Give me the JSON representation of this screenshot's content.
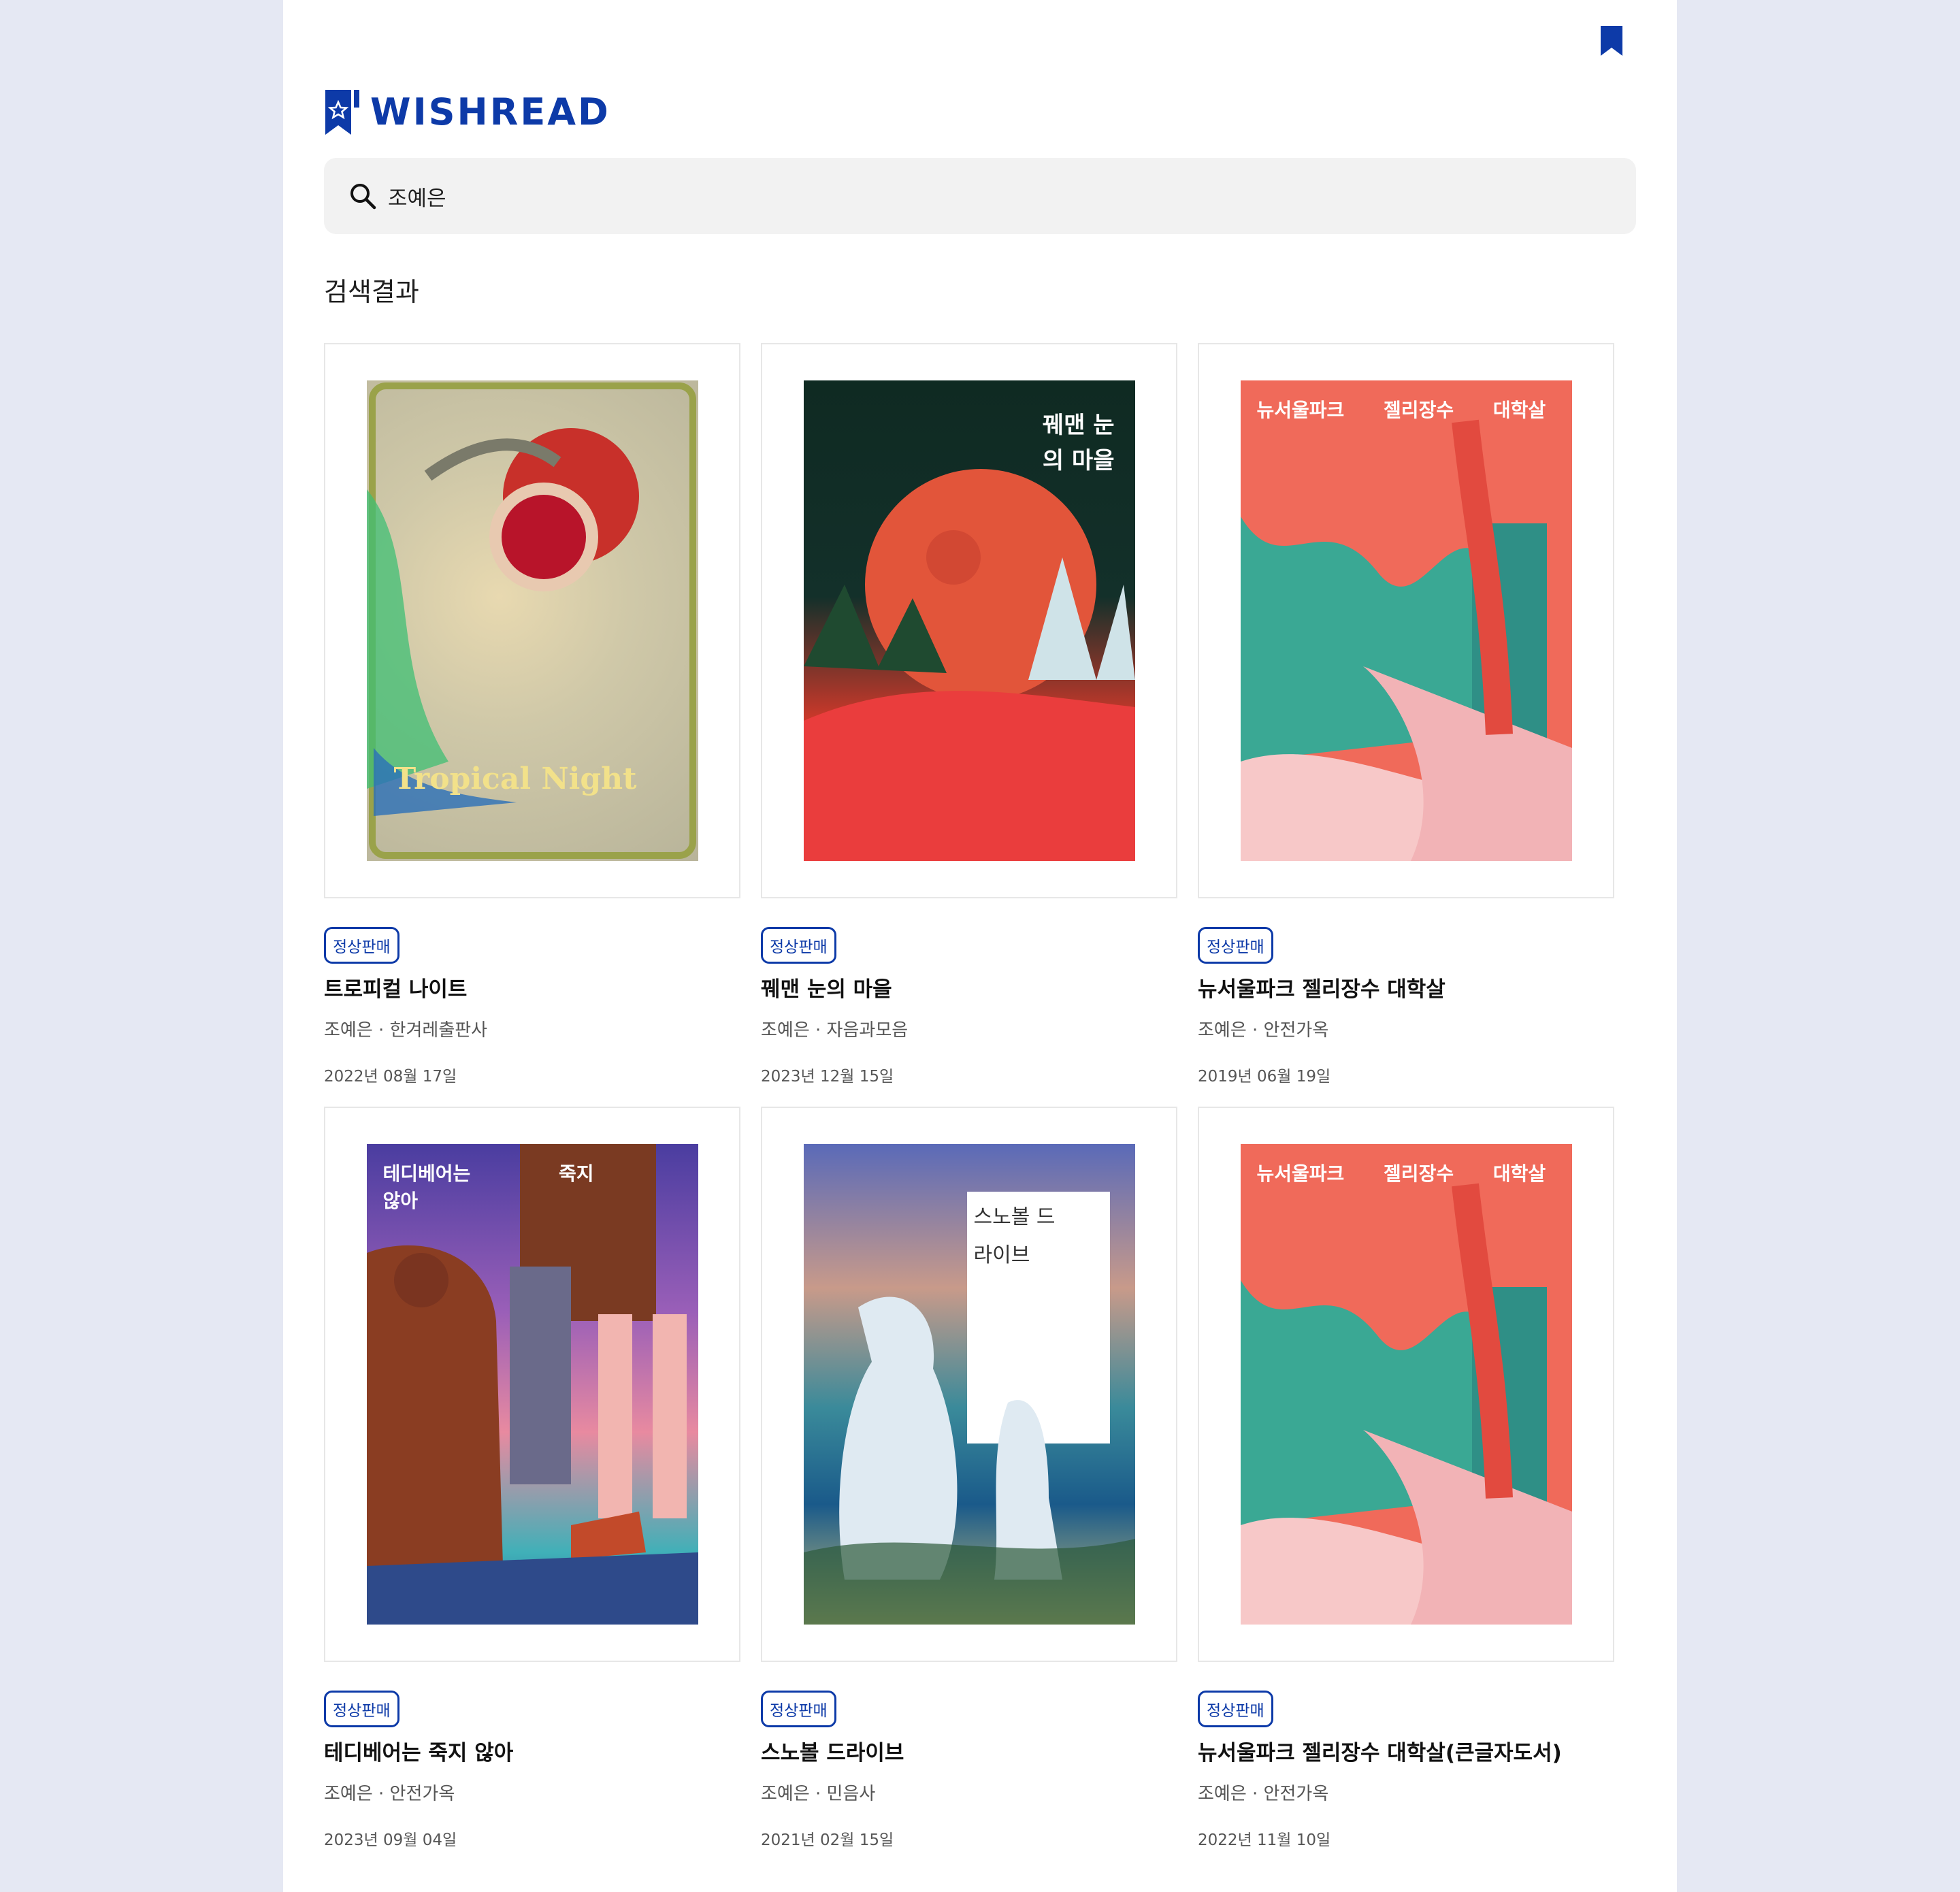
{
  "header": {
    "brand": "WISHREAD"
  },
  "search": {
    "value": "조예은"
  },
  "results": {
    "heading": "검색결과",
    "books": [
      {
        "status": "정상판매",
        "title": "트로피컬 나이트",
        "meta": "조예은 · 한겨레출판사",
        "date": "2022년 08월 17일",
        "cover_title": "Tropical Night"
      },
      {
        "status": "정상판매",
        "title": "꿰맨 눈의 마을",
        "meta": "조예은 · 자음과모음",
        "date": "2023년 12월 15일",
        "cover_title": "꿰맨 눈의 마을"
      },
      {
        "status": "정상판매",
        "title": "뉴서울파크 젤리장수 대학살",
        "meta": "조예은 · 안전가옥",
        "date": "2019년 06월 19일",
        "cover_title": "뉴서울파크 젤리장수 대학살"
      },
      {
        "status": "정상판매",
        "title": "테디베어는 죽지 않아",
        "meta": "조예은 · 안전가옥",
        "date": "2023년 09월 04일",
        "cover_title": "테디베어는 죽지 않아"
      },
      {
        "status": "정상판매",
        "title": "스노볼 드라이브",
        "meta": "조예은 · 민음사",
        "date": "2021년 02월 15일",
        "cover_title": "스노볼 드라이브"
      },
      {
        "status": "정상판매",
        "title": "뉴서울파크 젤리장수 대학살(큰글자도서)",
        "meta": "조예은 · 안전가옥",
        "date": "2022년 11월 10일",
        "cover_title": "뉴서울파크 젤리장수 대학살"
      }
    ]
  },
  "colors": {
    "brand": "#0d3aa8",
    "background": "#e5e8f3",
    "search_bg": "#f2f2f2"
  },
  "icons": [
    "bookmark-icon",
    "logo-bookmark-icon",
    "search-icon"
  ]
}
